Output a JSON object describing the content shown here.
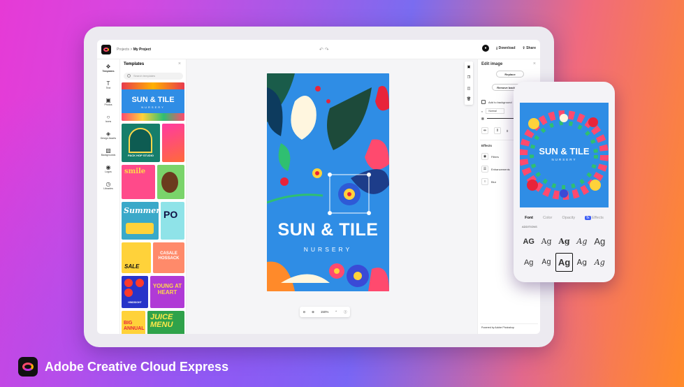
{
  "topbar": {
    "breadcrumb_root": "Projects",
    "breadcrumb_sep": ">",
    "breadcrumb_current": "My Project",
    "undo": "↶ ↷",
    "download_label": "Download",
    "share_label": "Share"
  },
  "rail": {
    "items": [
      {
        "label": "Templates",
        "icon": "templates-icon"
      },
      {
        "label": "Text",
        "icon": "text-icon"
      },
      {
        "label": "Photos",
        "icon": "photos-icon"
      },
      {
        "label": "Icons",
        "icon": "icons-icon"
      },
      {
        "label": "Design Assets",
        "icon": "design-assets-icon"
      },
      {
        "label": "Backgrounds",
        "icon": "backgrounds-icon"
      },
      {
        "label": "Logos",
        "icon": "logos-icon"
      },
      {
        "label": "Libraries",
        "icon": "libraries-icon"
      }
    ]
  },
  "templates": {
    "title": "Templates",
    "search_placeholder": "Search templates",
    "thumb_text": {
      "sun": "SUN & TILE",
      "nursery": "NURSERY",
      "summer": "Summer",
      "casale": "CASALE HOSSACK",
      "young": "YOUNG AT HEART",
      "juice": "JUICE MENU",
      "big": "BIG ANNUAL",
      "pack": "PACK HOP STUDIO",
      "smile": "smile",
      "sale": "SALE",
      "hindsight": "HINDSIGHT"
    }
  },
  "poster": {
    "title": "SUN & TILE",
    "subtitle": "NURSERY"
  },
  "zoom": {
    "level": "150%"
  },
  "edit_panel": {
    "title": "Edit image",
    "replace_label": "Replace",
    "remove_bg_label": "Remove background",
    "add_bg_label": "Add to background",
    "blend_label": "Normal",
    "effects_title": "Effects",
    "filters_label": "Filters",
    "enhancements_label": "Enhancements",
    "blur_label": "Blur",
    "powered_by": "Powered by Adobe Photoshop"
  },
  "phone": {
    "poster_title": "SUN & TILE",
    "poster_sub": "NURSERY",
    "tabs": [
      "Font",
      "Color",
      "Opacity",
      "Effects"
    ],
    "active_tab": "Font",
    "category": "ADDITIONS",
    "ag_tiles": [
      "AG",
      "Ag",
      "Ag",
      "Ag",
      "Ag",
      "Ag",
      "Ag",
      "Ag",
      "Ag",
      "Ag"
    ]
  },
  "brand": {
    "name": "Adobe Creative Cloud Express"
  },
  "colors": {
    "poster_bg": "#2f8de5",
    "accent": "#3b5cf5"
  }
}
